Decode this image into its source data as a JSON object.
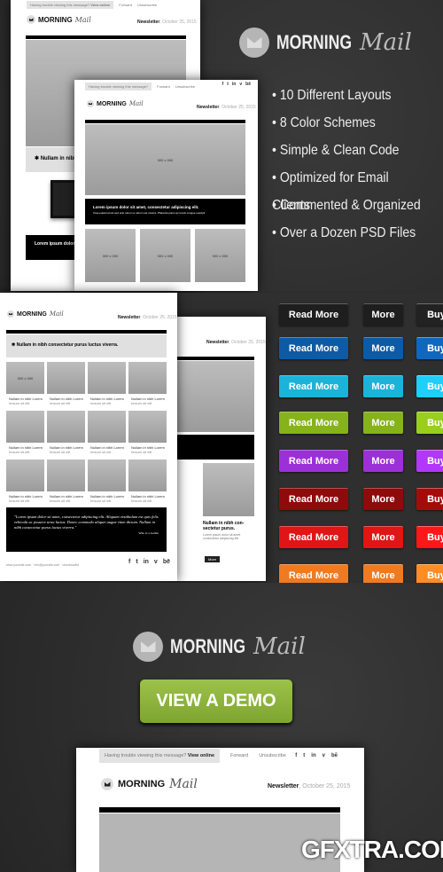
{
  "brand": {
    "word1": "MORNING",
    "word2": "Mail"
  },
  "features": [
    "• 10 Different Layouts",
    "• 8 Color Schemes",
    "• Simple & Clean Code",
    "• Optimized for Email Clients",
    "• Commented & Organized",
    "• Over a Dozen PSD Files"
  ],
  "email": {
    "trouble": "Having trouble viewing this message?",
    "view_online": "View online",
    "forward": "Forward",
    "unsubscribe": "Unsubscribe",
    "social": [
      "f",
      "t",
      "in",
      "v",
      "bē"
    ],
    "newsletter": "Newsletter",
    "date": ", October 25, 2015",
    "placeholder": "000 x 000",
    "headline": "Nullam in nibh consectetur purus luctus viverra.",
    "lorem_title": "Lorem ipsum dolor sit amet, consectetur adipiscing elit.",
    "lorem_body": "Cras euismod est sed erat rutrum a rutrum est viverra. Pharetra purus ac turpis congue suscipit",
    "item_title": "Nullam in nibh con-sectetur purus.",
    "grid_caption": "Nullam in nibh Lorem",
    "grid_sub": "Imsum sit elit",
    "quote": "\"Lorem ipsum dolor sit amet, consectetur adipiscing elit. Aliquam vestibulum est quis felis vehicula ac posuere urna luctus. Donec commodo aliquet augue vitae dictum. Nullam in nibh consectetur purus luctus viverra.\"",
    "quote_author": "Who is a Gentle",
    "footer": "www.yoursite.com · info@yoursite.com · unsubscribe",
    "more": "More",
    "body_text": "Lorem ipsum dolor sit amet consectetur adipiscing elit."
  },
  "buttons": {
    "labels": [
      "Read More",
      "More",
      "Buy"
    ],
    "colors": [
      "#1e1e1e",
      "#0d5aa7",
      "#1bb3d9",
      "#86b31a",
      "#9b30d9",
      "#8f0a0a",
      "#e01515",
      "#f07a20"
    ]
  },
  "cta": {
    "label": "VIEW A DEMO",
    "color": "#8db33a"
  },
  "watermark": "GFXTRA.COM"
}
